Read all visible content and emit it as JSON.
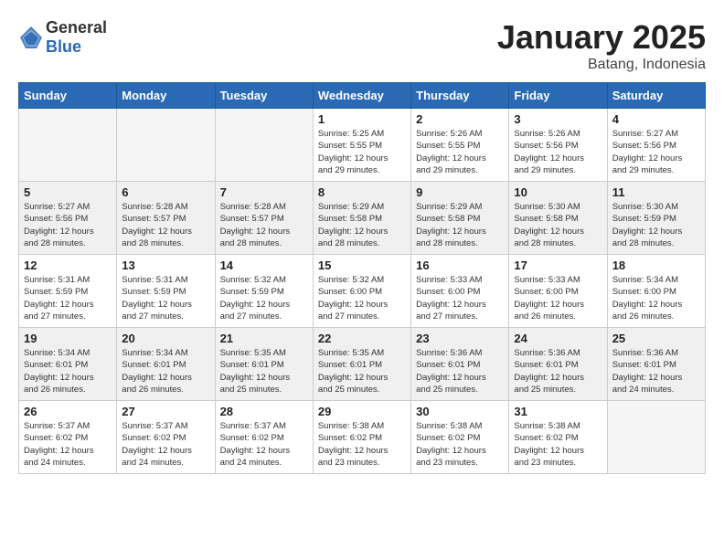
{
  "header": {
    "logo_general": "General",
    "logo_blue": "Blue",
    "month_title": "January 2025",
    "location": "Batang, Indonesia"
  },
  "weekdays": [
    "Sunday",
    "Monday",
    "Tuesday",
    "Wednesday",
    "Thursday",
    "Friday",
    "Saturday"
  ],
  "weeks": [
    {
      "days": [
        {
          "number": "",
          "info": "",
          "empty": true
        },
        {
          "number": "",
          "info": "",
          "empty": true
        },
        {
          "number": "",
          "info": "",
          "empty": true
        },
        {
          "number": "1",
          "info": "Sunrise: 5:25 AM\nSunset: 5:55 PM\nDaylight: 12 hours\nand 29 minutes."
        },
        {
          "number": "2",
          "info": "Sunrise: 5:26 AM\nSunset: 5:55 PM\nDaylight: 12 hours\nand 29 minutes."
        },
        {
          "number": "3",
          "info": "Sunrise: 5:26 AM\nSunset: 5:56 PM\nDaylight: 12 hours\nand 29 minutes."
        },
        {
          "number": "4",
          "info": "Sunrise: 5:27 AM\nSunset: 5:56 PM\nDaylight: 12 hours\nand 29 minutes."
        }
      ]
    },
    {
      "days": [
        {
          "number": "5",
          "info": "Sunrise: 5:27 AM\nSunset: 5:56 PM\nDaylight: 12 hours\nand 28 minutes."
        },
        {
          "number": "6",
          "info": "Sunrise: 5:28 AM\nSunset: 5:57 PM\nDaylight: 12 hours\nand 28 minutes."
        },
        {
          "number": "7",
          "info": "Sunrise: 5:28 AM\nSunset: 5:57 PM\nDaylight: 12 hours\nand 28 minutes."
        },
        {
          "number": "8",
          "info": "Sunrise: 5:29 AM\nSunset: 5:58 PM\nDaylight: 12 hours\nand 28 minutes."
        },
        {
          "number": "9",
          "info": "Sunrise: 5:29 AM\nSunset: 5:58 PM\nDaylight: 12 hours\nand 28 minutes."
        },
        {
          "number": "10",
          "info": "Sunrise: 5:30 AM\nSunset: 5:58 PM\nDaylight: 12 hours\nand 28 minutes."
        },
        {
          "number": "11",
          "info": "Sunrise: 5:30 AM\nSunset: 5:59 PM\nDaylight: 12 hours\nand 28 minutes."
        }
      ]
    },
    {
      "days": [
        {
          "number": "12",
          "info": "Sunrise: 5:31 AM\nSunset: 5:59 PM\nDaylight: 12 hours\nand 27 minutes."
        },
        {
          "number": "13",
          "info": "Sunrise: 5:31 AM\nSunset: 5:59 PM\nDaylight: 12 hours\nand 27 minutes."
        },
        {
          "number": "14",
          "info": "Sunrise: 5:32 AM\nSunset: 5:59 PM\nDaylight: 12 hours\nand 27 minutes."
        },
        {
          "number": "15",
          "info": "Sunrise: 5:32 AM\nSunset: 6:00 PM\nDaylight: 12 hours\nand 27 minutes."
        },
        {
          "number": "16",
          "info": "Sunrise: 5:33 AM\nSunset: 6:00 PM\nDaylight: 12 hours\nand 27 minutes."
        },
        {
          "number": "17",
          "info": "Sunrise: 5:33 AM\nSunset: 6:00 PM\nDaylight: 12 hours\nand 26 minutes."
        },
        {
          "number": "18",
          "info": "Sunrise: 5:34 AM\nSunset: 6:00 PM\nDaylight: 12 hours\nand 26 minutes."
        }
      ]
    },
    {
      "days": [
        {
          "number": "19",
          "info": "Sunrise: 5:34 AM\nSunset: 6:01 PM\nDaylight: 12 hours\nand 26 minutes."
        },
        {
          "number": "20",
          "info": "Sunrise: 5:34 AM\nSunset: 6:01 PM\nDaylight: 12 hours\nand 26 minutes."
        },
        {
          "number": "21",
          "info": "Sunrise: 5:35 AM\nSunset: 6:01 PM\nDaylight: 12 hours\nand 25 minutes."
        },
        {
          "number": "22",
          "info": "Sunrise: 5:35 AM\nSunset: 6:01 PM\nDaylight: 12 hours\nand 25 minutes."
        },
        {
          "number": "23",
          "info": "Sunrise: 5:36 AM\nSunset: 6:01 PM\nDaylight: 12 hours\nand 25 minutes."
        },
        {
          "number": "24",
          "info": "Sunrise: 5:36 AM\nSunset: 6:01 PM\nDaylight: 12 hours\nand 25 minutes."
        },
        {
          "number": "25",
          "info": "Sunrise: 5:36 AM\nSunset: 6:01 PM\nDaylight: 12 hours\nand 24 minutes."
        }
      ]
    },
    {
      "days": [
        {
          "number": "26",
          "info": "Sunrise: 5:37 AM\nSunset: 6:02 PM\nDaylight: 12 hours\nand 24 minutes."
        },
        {
          "number": "27",
          "info": "Sunrise: 5:37 AM\nSunset: 6:02 PM\nDaylight: 12 hours\nand 24 minutes."
        },
        {
          "number": "28",
          "info": "Sunrise: 5:37 AM\nSunset: 6:02 PM\nDaylight: 12 hours\nand 24 minutes."
        },
        {
          "number": "29",
          "info": "Sunrise: 5:38 AM\nSunset: 6:02 PM\nDaylight: 12 hours\nand 23 minutes."
        },
        {
          "number": "30",
          "info": "Sunrise: 5:38 AM\nSunset: 6:02 PM\nDaylight: 12 hours\nand 23 minutes."
        },
        {
          "number": "31",
          "info": "Sunrise: 5:38 AM\nSunset: 6:02 PM\nDaylight: 12 hours\nand 23 minutes."
        },
        {
          "number": "",
          "info": "",
          "empty": true
        }
      ]
    }
  ]
}
